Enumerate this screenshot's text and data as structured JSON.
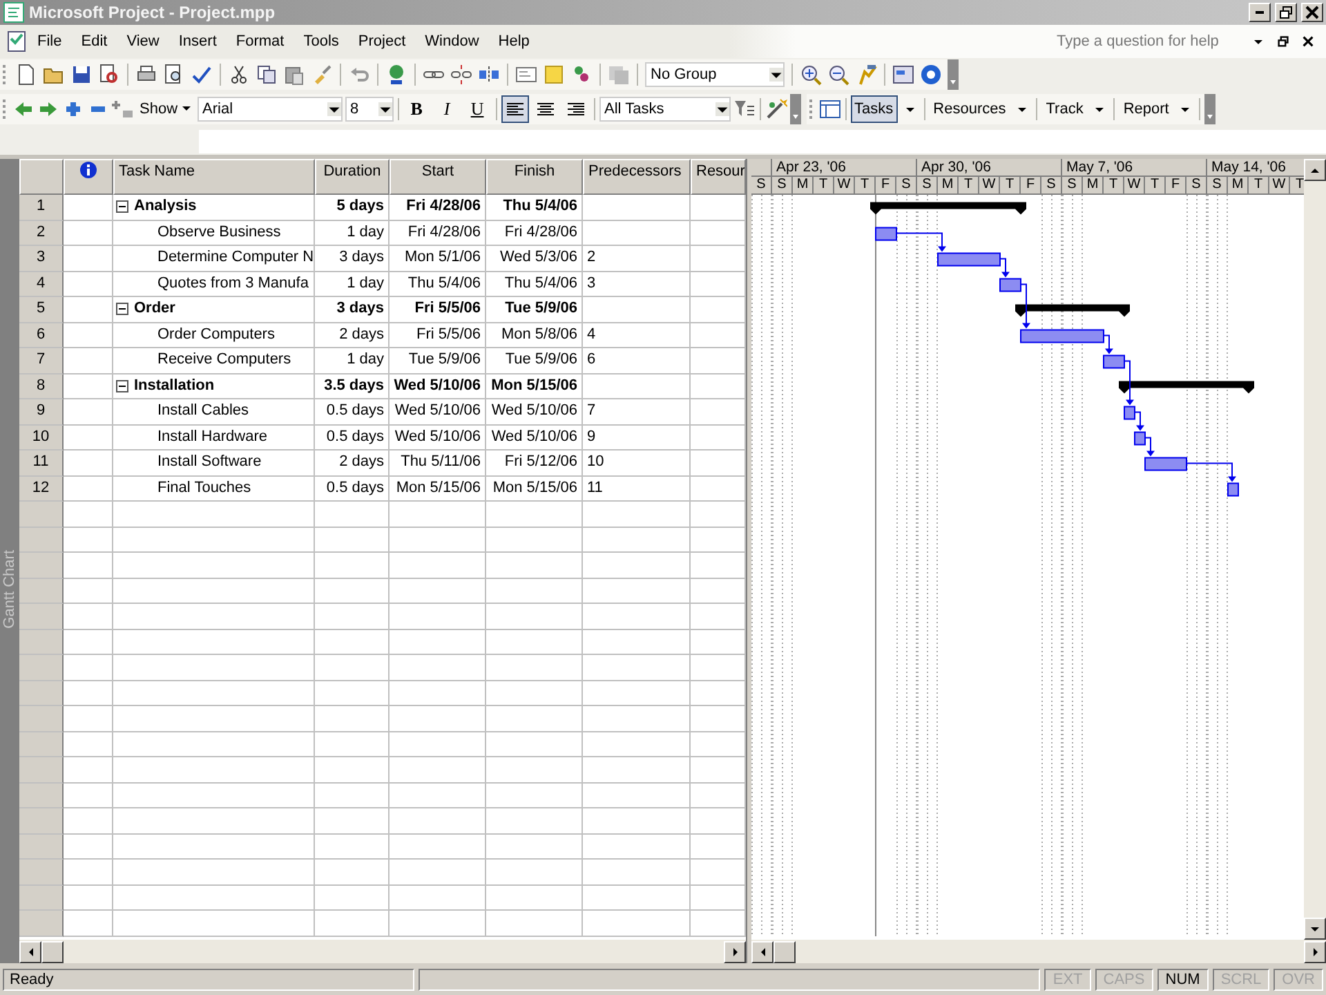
{
  "window": {
    "title": "Microsoft Project - Project.mpp"
  },
  "menu": [
    "File",
    "Edit",
    "View",
    "Insert",
    "Format",
    "Tools",
    "Project",
    "Window",
    "Help"
  ],
  "help_box": {
    "placeholder": "Type a question for help"
  },
  "standard_toolbar": {
    "group": "No Group"
  },
  "formatting_toolbar": {
    "show": "Show",
    "font": "Arial",
    "size": "8",
    "format_buttons": [
      {
        "label": "B",
        "kind": "bold",
        "selected": false
      },
      {
        "label": "I",
        "kind": "italic",
        "selected": false
      },
      {
        "label": "U",
        "kind": "underline",
        "selected": false
      }
    ],
    "align_buttons": [
      {
        "kind": "left",
        "selected": true
      },
      {
        "kind": "center",
        "selected": false
      },
      {
        "kind": "right",
        "selected": false
      }
    ],
    "filter": "All Tasks"
  },
  "guide_toolbar": [
    {
      "label": "Tasks",
      "selected": true
    },
    {
      "label": "Resources",
      "selected": false
    },
    {
      "label": "Track",
      "selected": false
    },
    {
      "label": "Report",
      "selected": false
    }
  ],
  "view_bar": {
    "label": "Gantt Chart"
  },
  "table": {
    "columns": [
      "Task Name",
      "Duration",
      "Start",
      "Finish",
      "Predecessors",
      "Resour"
    ],
    "tasks": [
      {
        "id": "1",
        "name": "Analysis",
        "duration": "5 days",
        "start": "Fri 4/28/06",
        "finish": "Thu 5/4/06",
        "expanded": true,
        "children": [
          {
            "id": "2",
            "name": "Observe Business",
            "duration": "1 day",
            "start": "Fri 4/28/06",
            "finish": "Fri 4/28/06"
          },
          {
            "id": "3",
            "name": "Determine Computer N",
            "duration": "3 days",
            "start": "Mon 5/1/06",
            "finish": "Wed 5/3/06",
            "predecessors": "2"
          },
          {
            "id": "4",
            "name": "Quotes from 3 Manufa",
            "duration": "1 day",
            "start": "Thu 5/4/06",
            "finish": "Thu 5/4/06",
            "predecessors": "3"
          }
        ]
      },
      {
        "id": "5",
        "name": "Order",
        "duration": "3 days",
        "start": "Fri 5/5/06",
        "finish": "Tue 5/9/06",
        "expanded": true,
        "children": [
          {
            "id": "6",
            "name": "Order Computers",
            "duration": "2 days",
            "start": "Fri 5/5/06",
            "finish": "Mon 5/8/06",
            "predecessors": "4"
          },
          {
            "id": "7",
            "name": "Receive Computers",
            "duration": "1 day",
            "start": "Tue 5/9/06",
            "finish": "Tue 5/9/06",
            "predecessors": "6"
          }
        ]
      },
      {
        "id": "8",
        "name": "Installation",
        "duration": "3.5 days",
        "start": "Wed 5/10/06",
        "finish": "Mon 5/15/06",
        "expanded": true,
        "children": [
          {
            "id": "9",
            "name": "Install Cables",
            "duration": "0.5 days",
            "start": "Wed 5/10/06",
            "finish": "Wed 5/10/06",
            "predecessors": "7"
          },
          {
            "id": "10",
            "name": "Install Hardware",
            "duration": "0.5 days",
            "start": "Wed 5/10/06",
            "finish": "Wed 5/10/06",
            "predecessors": "9"
          },
          {
            "id": "11",
            "name": "Install Software",
            "duration": "2 days",
            "start": "Thu 5/11/06",
            "finish": "Fri 5/12/06",
            "predecessors": "10"
          },
          {
            "id": "12",
            "name": "Final Touches",
            "duration": "0.5 days",
            "start": "Mon 5/15/06",
            "finish": "Mon 5/15/06",
            "predecessors": "11"
          }
        ]
      }
    ]
  },
  "timescale": {
    "weeks": [
      "Apr 23, '06",
      "Apr 30, '06",
      "May 7, '06",
      "May 14, '06"
    ],
    "days": [
      "S",
      "S",
      "M",
      "T",
      "W",
      "T",
      "F",
      "S",
      "S",
      "M",
      "T",
      "W",
      "T",
      "F",
      "S",
      "S",
      "M",
      "T",
      "W",
      "T",
      "F",
      "S",
      "S",
      "M",
      "T",
      "W",
      "T"
    ]
  },
  "status_bar": {
    "text": "Ready",
    "indicators": [
      {
        "label": "EXT",
        "on": false
      },
      {
        "label": "CAPS",
        "on": false
      },
      {
        "label": "NUM",
        "on": true
      },
      {
        "label": "SCRL",
        "on": false
      },
      {
        "label": "OVR",
        "on": false
      }
    ]
  }
}
